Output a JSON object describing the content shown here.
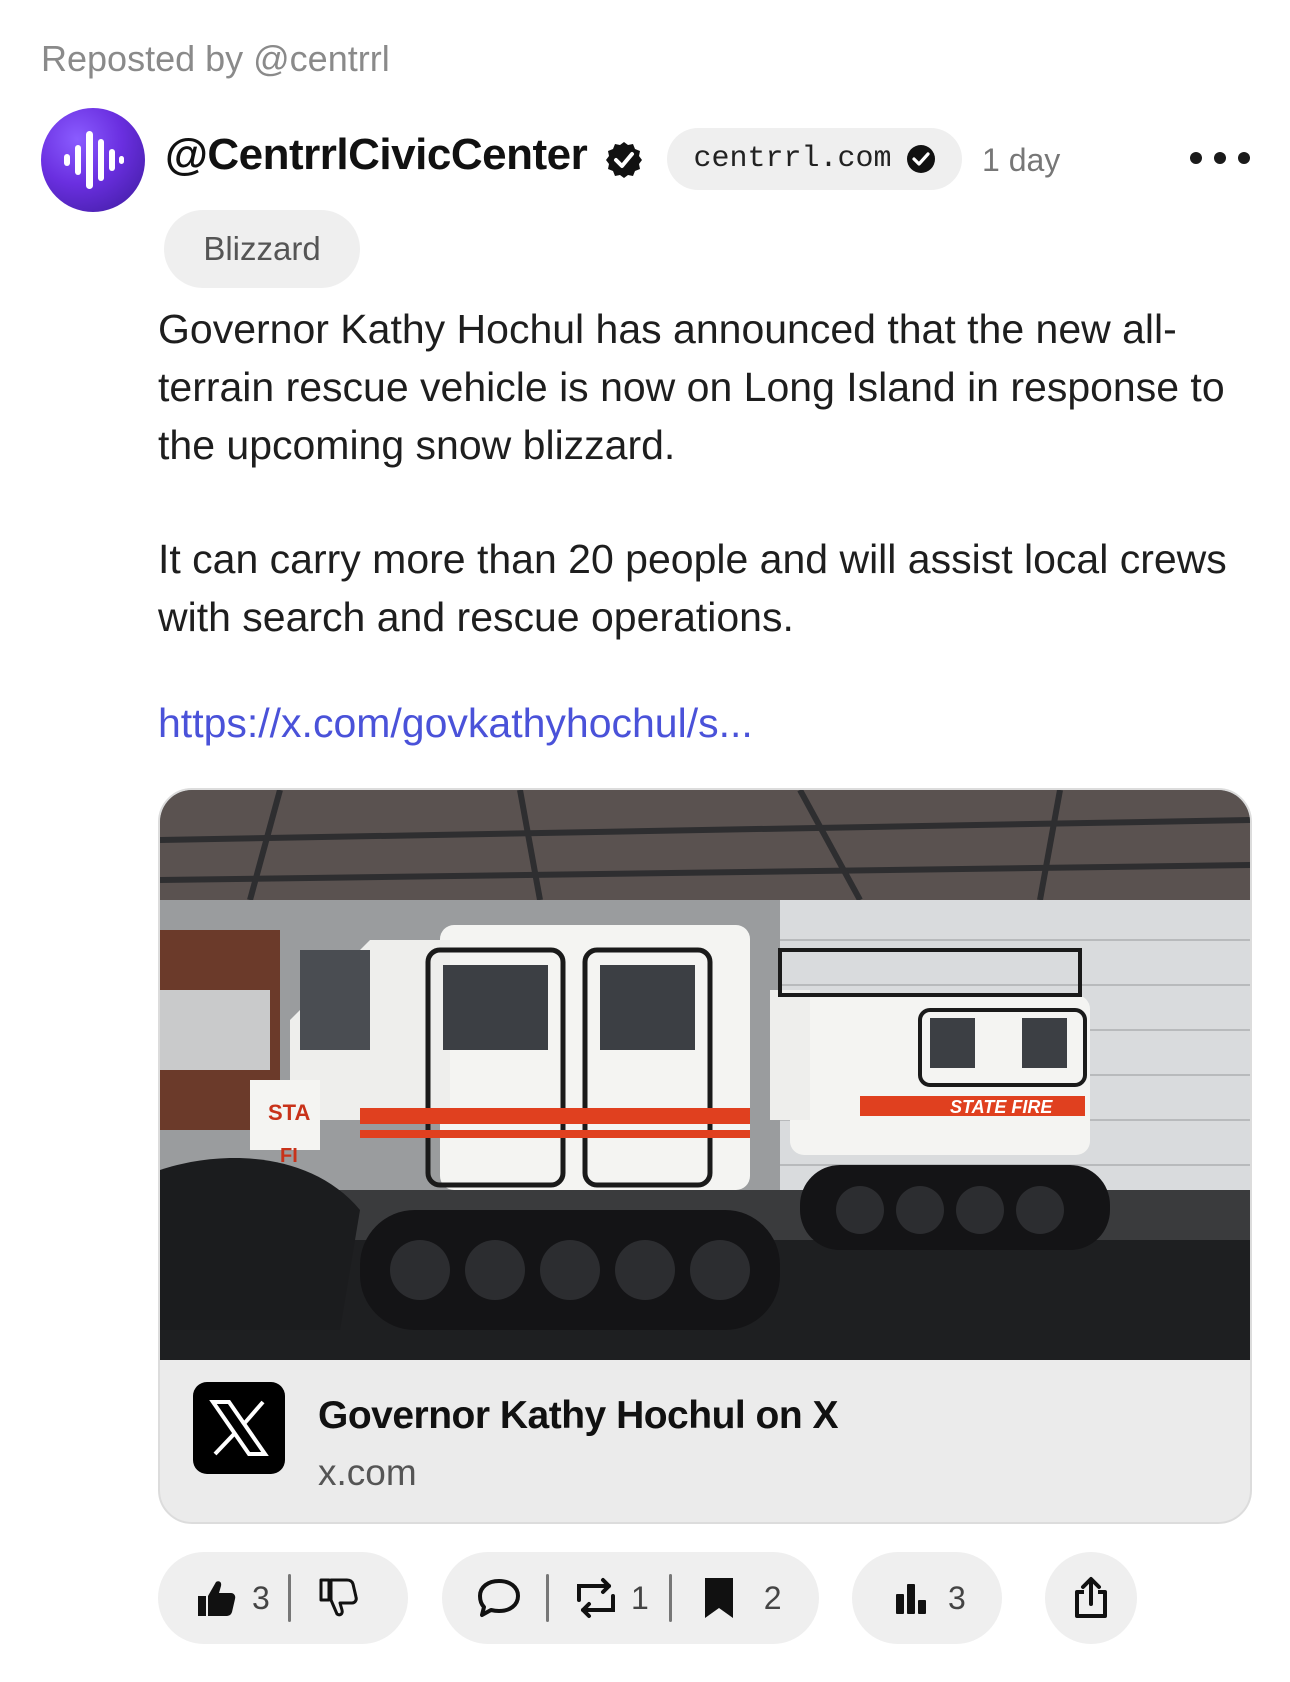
{
  "repost": {
    "text": "Reposted by @centrrl"
  },
  "post": {
    "handle": "@CentrrlCivicCenter",
    "domain": "centrrl.com",
    "time": "1 day",
    "tag": "Blizzard",
    "paragraphs": [
      "Governor Kathy Hochul has announced that the new all-terrain rescue vehicle is now on Long Island in response to the upcoming snow blizzard.",
      "It can carry more than 20 people and will assist local crews with search and rescue operations."
    ],
    "link": "https://x.com/govkathyhochul/s..."
  },
  "card": {
    "title": "Governor Kathy Hochul on X",
    "domain": "x.com",
    "image_labels": {
      "state_fire": "STATE FIRE",
      "sta": "STA",
      "fi": "FI"
    }
  },
  "actions": {
    "likes": "3",
    "reposts": "1",
    "bookmarks": "2",
    "views": "3"
  },
  "colors": {
    "link": "#4a52d9",
    "accent_purple": "#6a2fe0",
    "stripe_red": "#e0401f"
  }
}
